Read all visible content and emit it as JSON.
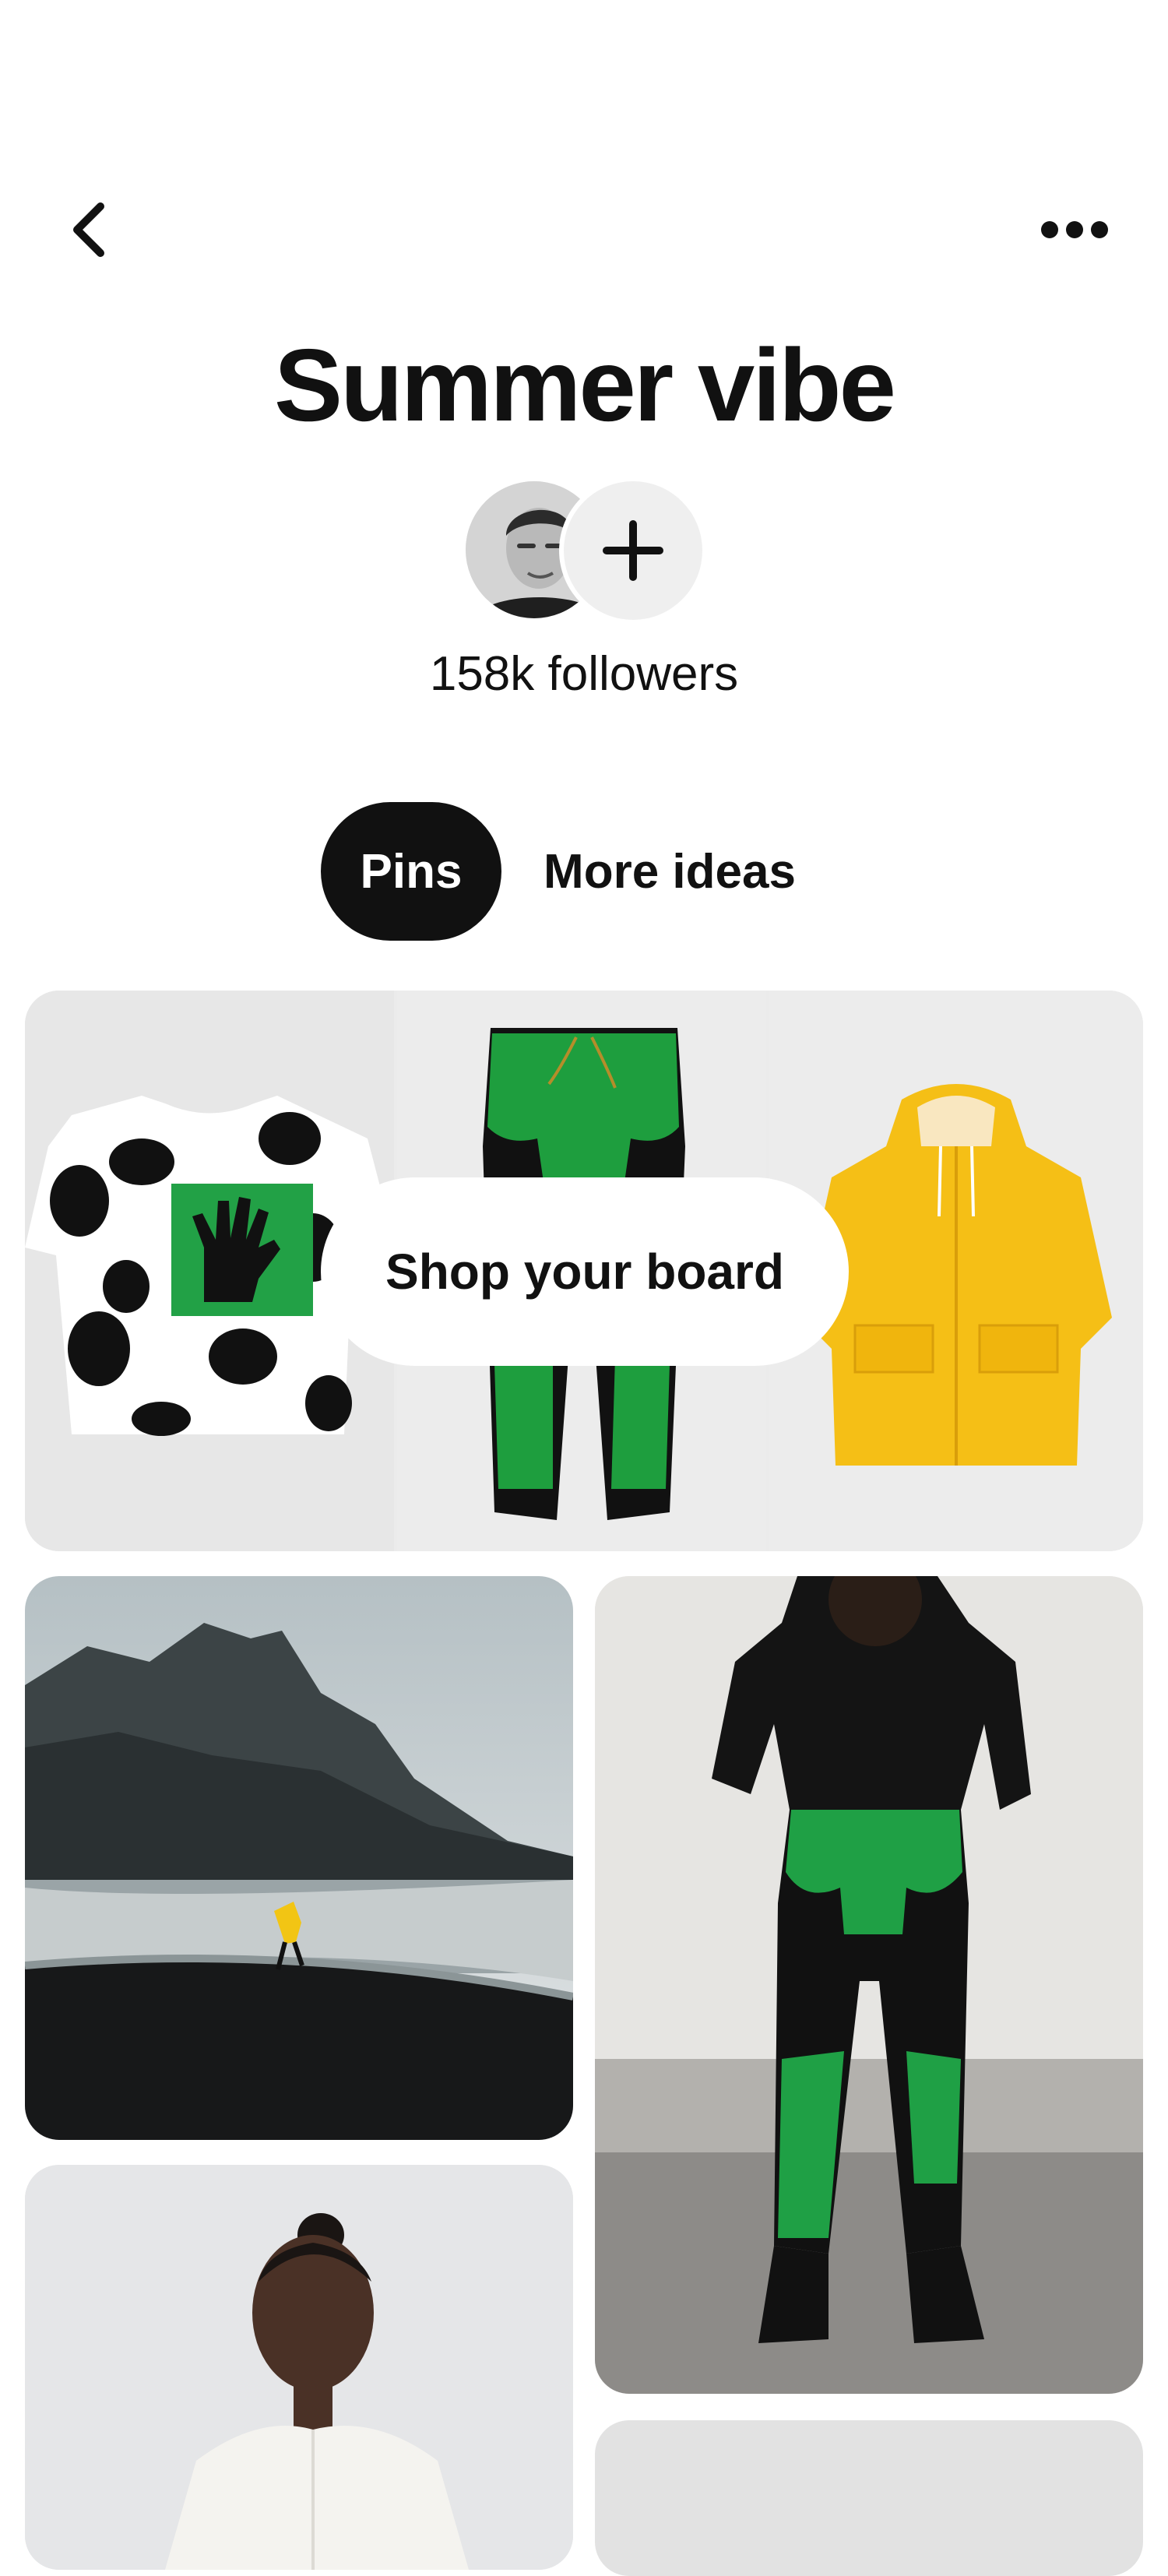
{
  "header": {
    "back_icon": "chevron-left-icon",
    "more_icon": "ellipsis-icon"
  },
  "board": {
    "title": "Summer vibe",
    "followers": "158k followers",
    "add_collaborator_icon": "plus-icon"
  },
  "tabs": [
    {
      "label": "Pins",
      "active": true
    },
    {
      "label": "More ideas",
      "active": false
    }
  ],
  "shop": {
    "label": "Shop your board"
  },
  "colors": {
    "accent_dark": "#111111",
    "background": "#ffffff",
    "pill_bg": "#efefef",
    "green": "#1aa34a",
    "yellow": "#f7c21a"
  }
}
